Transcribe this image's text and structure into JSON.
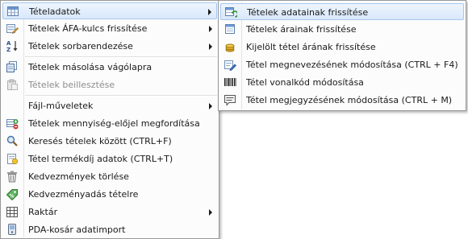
{
  "main_menu": {
    "items": [
      {
        "label": "Tételadatok",
        "icon": "table-grid-icon",
        "submenu": true,
        "highlighted": true
      },
      {
        "label": "Tételek ÁFA-kulcs frissítése",
        "icon": "vat-edit-icon",
        "submenu": true
      },
      {
        "label": "Tételek sorbarendezése",
        "icon": "sort-az-icon",
        "submenu": true
      },
      {
        "label": "Tételek másolása vágólapra",
        "icon": "copy-icon"
      },
      {
        "label": "Tételek beillesztése",
        "icon": "paste-icon",
        "disabled": true
      },
      {
        "label": "Fájl-műveletek",
        "icon": "file-icon",
        "submenu": true
      },
      {
        "label": "Tételek mennyiség-előjel megfordítása",
        "icon": "sign-flip-icon"
      },
      {
        "label": "Keresés tételek között (CTRL+F)",
        "icon": "search-icon"
      },
      {
        "label": "Tétel termékdíj adatok (CTRL+T)",
        "icon": "fee-icon"
      },
      {
        "label": "Kedvezmények törlése",
        "icon": "trash-icon"
      },
      {
        "label": "Kedvezményadás tételre",
        "icon": "discount-tag-icon"
      },
      {
        "label": "Raktár",
        "icon": "warehouse-icon",
        "submenu": true
      },
      {
        "label": "PDA-kosár adatimport",
        "icon": "pda-icon"
      }
    ]
  },
  "sub_menu": {
    "items": [
      {
        "label": "Tételek adatainak frissítése",
        "icon": "refresh-data-icon",
        "highlighted": true
      },
      {
        "label": "Tételek árainak frissítése",
        "icon": "price-list-icon"
      },
      {
        "label": "Kijelölt tétel árának frissítése",
        "icon": "coin-icon"
      },
      {
        "label": "Tétel megnevezésének módosítása (CTRL + F4)",
        "icon": "rename-icon"
      },
      {
        "label": "Tétel vonalkód módosítása",
        "icon": "barcode-icon"
      },
      {
        "label": "Tétel megjegyzésének módosítása (CTRL + M)",
        "icon": "note-icon"
      }
    ]
  },
  "colors": {
    "highlight_top": "#eef5fd",
    "highlight_bottom": "#d8e8fb",
    "highlight_border": "#a6c8ef",
    "disabled_text": "#8d8d8d",
    "menu_border": "#979797"
  }
}
